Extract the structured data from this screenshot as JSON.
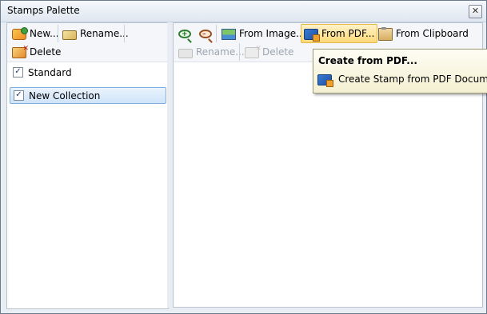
{
  "window": {
    "title": "Stamps Palette",
    "close_glyph": "✕"
  },
  "left_toolbar": {
    "new_label": "New...",
    "rename_label": "Rename...",
    "delete_label": "Delete"
  },
  "collections": [
    {
      "label": "Standard",
      "checked": true,
      "selected": false
    },
    {
      "label": "New Collection",
      "checked": true,
      "selected": true
    }
  ],
  "right_toolbar": {
    "zoom_in_icon": "zoom-in-icon",
    "zoom_out_icon": "zoom-out-icon",
    "from_image_label": "From Image...",
    "from_pdf_label": "From PDF...",
    "from_clipboard_label": "From Clipboard",
    "rename_label": "Rename...",
    "delete_label": "Delete"
  },
  "tooltip": {
    "title": "Create from PDF...",
    "description": "Create Stamp from PDF Document."
  },
  "colors": {
    "selection_border": "#84acdd",
    "hot_button": "#ffd978",
    "tooltip_bg": "#f4f0d2"
  }
}
